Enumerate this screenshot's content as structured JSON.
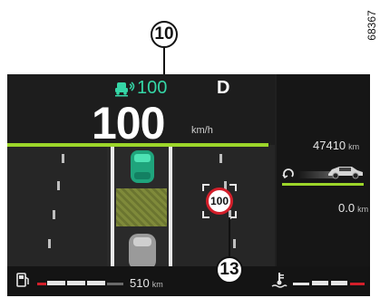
{
  "callouts": {
    "top": "10",
    "bottom": "13"
  },
  "reference_code": "68367",
  "header": {
    "cruise_icon": "adaptive-cruise-icon",
    "cruise_set_speed": "100",
    "gear": "D"
  },
  "speed": {
    "value": "100",
    "unit": "km/h"
  },
  "traffic_sign": {
    "icon": "speed-limit-sign-icon",
    "value": "100"
  },
  "right_panel": {
    "odometer_value": "47410",
    "odometer_unit": "km",
    "trip_value": "0.0",
    "trip_unit": "km"
  },
  "bottom": {
    "fuel_icon": "fuel-pump-icon",
    "range_value": "510",
    "range_unit": "km",
    "coolant_icon": "coolant-temp-icon"
  },
  "colors": {
    "accent_green": "#9cd62a",
    "cruise_teal": "#35d6a6",
    "sign_red": "#d31f2a"
  }
}
